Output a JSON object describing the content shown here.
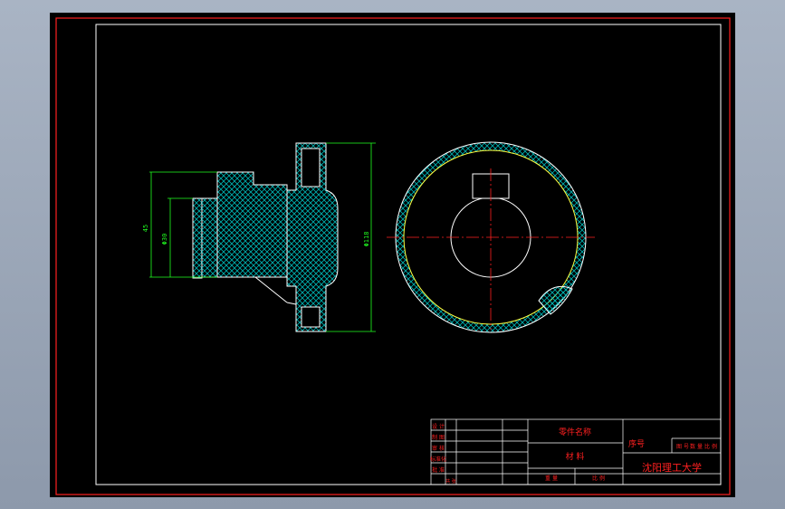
{
  "colors": {
    "background": "#000000",
    "frame": "#ff2020",
    "inner_frame": "#ffffff",
    "outline": "#ffffff",
    "hatch": "#00c8c8",
    "dimension": "#20ff20",
    "centerline": "#ff2020",
    "contour": "#ffff40"
  },
  "dimensions": {
    "d1": "45",
    "d2": "Φ30",
    "d3": "Φ118"
  },
  "title_block": {
    "part_name_label": "零件名称",
    "material_label": "材 料",
    "serial_label": "序号",
    "university": "沈阳理工大学",
    "col_a": "图 号",
    "col_b": "数 量",
    "col_c": "比 例",
    "row_design": "设 计",
    "row_draw": "制 图",
    "row_check": "审 核",
    "row_std": "标准化",
    "row_approve": "批 准",
    "sub_weight": "重 量",
    "sub_scale": "比 例",
    "sub_sheet": "共 张"
  }
}
